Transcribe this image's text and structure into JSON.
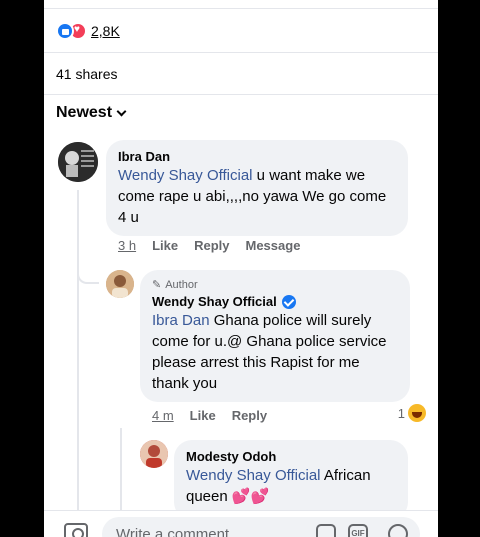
{
  "reactions": {
    "count": "2,8K",
    "types": [
      "like",
      "love"
    ]
  },
  "shares": "41 shares",
  "sort": {
    "label": "Newest"
  },
  "comments": [
    {
      "name": "Ibra Dan",
      "mention": "Wendy Shay Official",
      "text": " u want make we come rape u abi,,,,no yawa We go come 4 u",
      "time": "3 h",
      "actions": [
        "Like",
        "Reply",
        "Message"
      ]
    },
    {
      "badge": "Author",
      "name": "Wendy Shay Official",
      "verified": true,
      "mention": "Ibra Dan",
      "text": " Ghana police will surely come for u.@ Ghana police service please arrest this Rapist for me thank you",
      "time": "4 m",
      "actions": [
        "Like",
        "Reply"
      ],
      "reaction_count": "1"
    },
    {
      "name": "Modesty Odoh",
      "mention": "Wendy Shay Official",
      "text": " African queen",
      "emoji": "💕💕"
    }
  ],
  "composer": {
    "placeholder": "Write a comment",
    "gif_label": "GIF"
  },
  "colors": {
    "mention": "#385898",
    "bubble": "#f0f2f5",
    "like": "#1877f2",
    "love": "#f33e58"
  }
}
